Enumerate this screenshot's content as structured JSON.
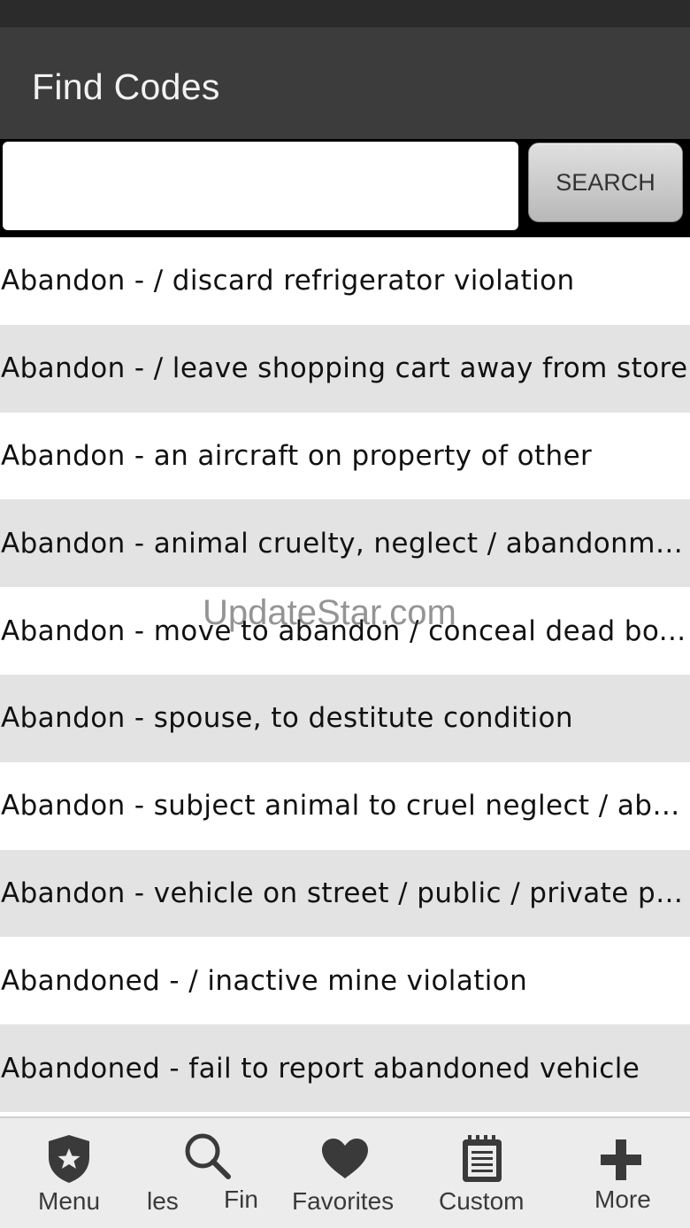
{
  "app_bar": {
    "title": "Find Codes"
  },
  "search": {
    "value": "",
    "placeholder": "",
    "button_label": "SEARCH"
  },
  "results": [
    "Abandon - / discard refrigerator violation",
    "Abandon - / leave shopping cart away from store",
    "Abandon - an aircraft on property of other",
    "Abandon - animal cruelty, neglect / abandonme...",
    "Abandon - move to abandon / conceal dead bo...",
    "Abandon - spouse, to destitute condition",
    "Abandon - subject animal to cruel neglect / aba...",
    "Abandon - vehicle on street / public / private pr...",
    "Abandoned - / inactive mine violation",
    "Abandoned - fail to report abandoned vehicle"
  ],
  "watermark": "UpdateStar.com",
  "bottom_nav": {
    "menu": {
      "label": "Menu",
      "icon": "shield-star-icon"
    },
    "partial_left": {
      "label": "les"
    },
    "find": {
      "label": "Fin",
      "icon": "search-icon"
    },
    "favorites": {
      "label": "Favorites",
      "icon": "heart-icon"
    },
    "custom": {
      "label": "Custom",
      "icon": "clipboard-icon"
    },
    "more": {
      "label": "More",
      "icon": "plus-icon"
    }
  }
}
